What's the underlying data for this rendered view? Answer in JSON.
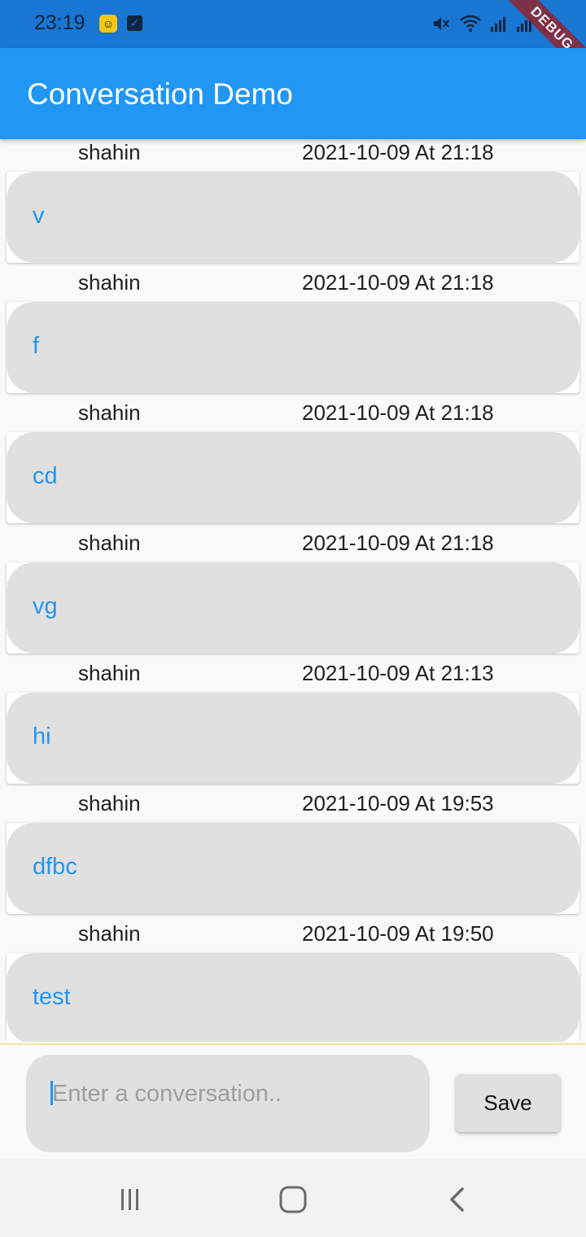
{
  "status_bar": {
    "time": "23:19",
    "icons": [
      "app-notification-icon",
      "checkbox-notification-icon",
      "mute-icon",
      "wifi-icon",
      "signal-icon",
      "signal-icon-2",
      "battery-icon"
    ]
  },
  "debug_banner": "DEBUG",
  "app_bar": {
    "title": "Conversation Demo"
  },
  "conversations": [
    {
      "user": "shahin",
      "time": "2021-10-09 At 21:18",
      "text": "v"
    },
    {
      "user": "shahin",
      "time": "2021-10-09 At 21:18",
      "text": "f"
    },
    {
      "user": "shahin",
      "time": "2021-10-09 At 21:18",
      "text": "cd"
    },
    {
      "user": "shahin",
      "time": "2021-10-09 At 21:18",
      "text": "vg"
    },
    {
      "user": "shahin",
      "time": "2021-10-09 At 21:13",
      "text": "hi"
    },
    {
      "user": "shahin",
      "time": "2021-10-09 At 19:53",
      "text": "dfbc"
    },
    {
      "user": "shahin",
      "time": "2021-10-09 At 19:50",
      "text": "test"
    }
  ],
  "composer": {
    "value": "",
    "placeholder": "Enter a conversation..",
    "save_label": "Save"
  },
  "colors": {
    "primary": "#2196f3",
    "status_bar": "#1976d2",
    "bubble": "#e0e0e0",
    "debug_ribbon": "#8b2a3a"
  },
  "nav_bar": {
    "icons": [
      "recent-apps-icon",
      "home-icon",
      "back-icon"
    ]
  }
}
